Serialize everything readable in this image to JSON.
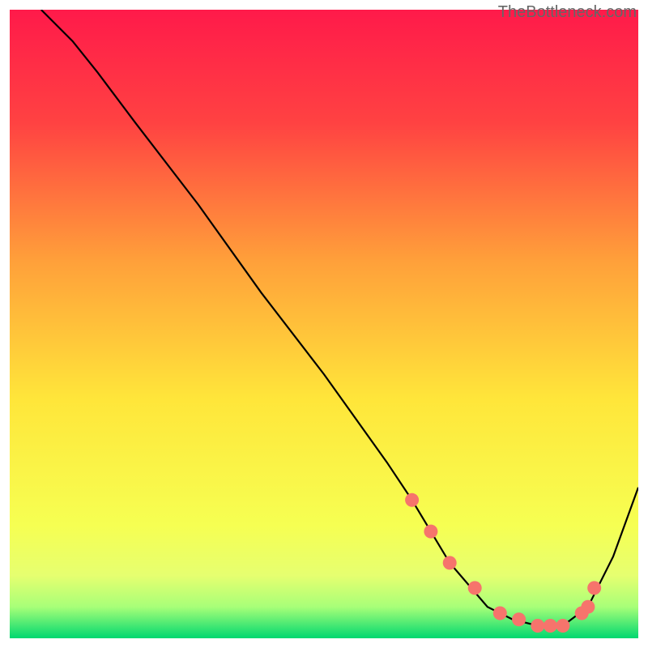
{
  "watermark": "TheBottleneck.com",
  "chart_data": {
    "type": "line",
    "title": "",
    "xlabel": "",
    "ylabel": "",
    "xlim": [
      0,
      100
    ],
    "ylim": [
      0,
      100
    ],
    "legend": false,
    "grid": false,
    "background_gradient": {
      "top_color": "#ff1a4a",
      "mid_color": "#ffe63a",
      "bottom_near": "#f2ff66",
      "bottom_color": "#00d870"
    },
    "series": [
      {
        "name": "curve",
        "type": "line",
        "color": "#000000",
        "x": [
          5,
          10,
          14,
          20,
          30,
          40,
          50,
          60,
          64,
          70,
          76,
          80,
          84,
          88,
          92,
          96,
          100
        ],
        "values": [
          100,
          95,
          90,
          82,
          69,
          55,
          42,
          28,
          22,
          12,
          5,
          3,
          2,
          2,
          5,
          13,
          24
        ]
      },
      {
        "name": "markers",
        "type": "scatter",
        "color": "#f6746c",
        "x": [
          64,
          67,
          70,
          74,
          78,
          81,
          84,
          86,
          88,
          91,
          92,
          93
        ],
        "values": [
          22,
          17,
          12,
          8,
          4,
          3,
          2,
          2,
          2,
          4,
          5,
          8
        ]
      }
    ]
  }
}
